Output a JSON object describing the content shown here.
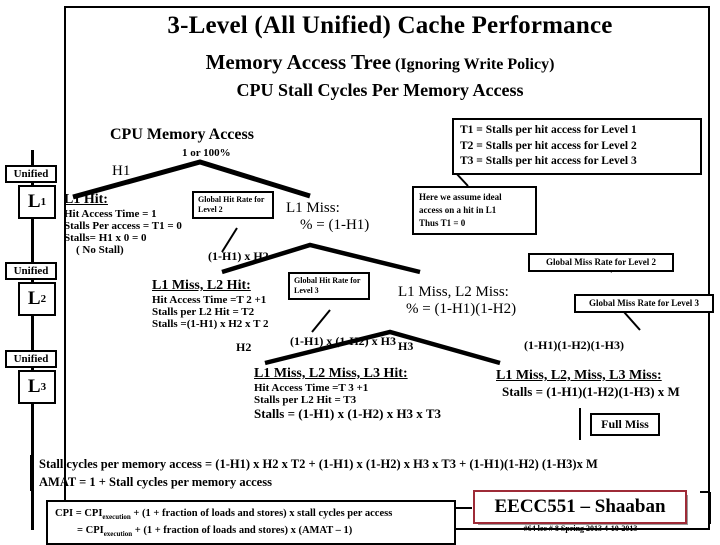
{
  "slide": {
    "title": "3-Level (All Unified) Cache Performance",
    "subtitle_main": "Memory Access Tree",
    "subtitle_paren": "(Ignoring Write Policy)",
    "subtitle_line3": "CPU Stall Cycles Per Memory Access"
  },
  "legend": {
    "t1": "T1 = Stalls per hit access for Level 1",
    "t2": "T2 = Stalls per hit access for Level 2",
    "t3": "T3  = Stalls per hit access for Level 3"
  },
  "tree": {
    "root_label": "CPU Memory  Access",
    "root_rate": "1 or 100%",
    "h1_branch_label": "H1"
  },
  "cache_column": [
    {
      "unified": "Unified",
      "level": "L",
      "sub": "1"
    },
    {
      "unified": "Unified",
      "level": "L",
      "sub": "2"
    },
    {
      "unified": "Unified",
      "level": "L",
      "sub": "3"
    }
  ],
  "nodes": {
    "l1_hit": {
      "title": "L1  Hit:",
      "lines": [
        "Hit Access Time = 1",
        "Stalls Per access = T1 = 0",
        "Stalls= H1 x 0 = 0",
        "( No Stall)"
      ]
    },
    "l1_miss": {
      "title": "L1  Miss:",
      "pct": "%  =  (1-H1)"
    },
    "l1miss_l2hit": {
      "title": "L1  Miss, L2  Hit:",
      "lines": [
        "Hit Access Time =T 2 +1",
        "Stalls per L2 Hit = T2",
        "Stalls =(1-H1) x H2 x T 2"
      ]
    },
    "l1miss_l2miss": {
      "title": "L1  Miss, L2   Miss:",
      "pct": "%  =    (1-H1)(1-H2)"
    },
    "l3_hit": {
      "title": "L1  Miss, L2 Miss, L3  Hit:",
      "lines": [
        "Hit Access Time =T 3 +1",
        "Stalls per L2 Hit = T3"
      ],
      "stalls": "Stalls =  (1-H1) x (1-H2) x H3 x  T3"
    },
    "l3_miss": {
      "title": "L1  Miss, L2, Miss, L3   Miss:",
      "stalls": "Stalls = (1-H1)(1-H2)(1-H3) x M"
    }
  },
  "callouts": {
    "global_hit_l2": "Global Hit Rate for Level 2",
    "global_hit_l3": "Global Hit Rate for Level 3",
    "global_miss_l2": "Global Miss Rate for  Level 2",
    "global_miss_l3": "Global Miss Rate for Level 3",
    "ideal_note": "Here we assume ideal access on a hit in L1 Thus  T1 = 0",
    "ideal_note_lines": [
      "Here we assume ideal",
      "access on a hit in L1",
      "Thus   T1 = 0"
    ],
    "full_miss": "Full Miss"
  },
  "fractions": {
    "l2_hit_frac": "(1-H1) x H2",
    "l2_miss_frac": "(1-H1) x (1-H2) x H3",
    "l3_miss_frac": "(1-H1)(1-H2)(1-H3)"
  },
  "branch_labels": {
    "h2": "H2",
    "h3": "H3"
  },
  "summary": {
    "stall_cycles": "Stall cycles per memory access   =  (1-H1) x H2 x T2  +  (1-H1) x (1-H2) x H3 x T3   + (1-H1)(1-H2) (1-H3)x M",
    "amat": "AMAT  =  1  + Stall cycles per memory access"
  },
  "cpi_box": {
    "line1_pre": "CPI = CPI",
    "line1_sub": "execution",
    "line1_post": "  +  (1 + fraction of loads and stores) x stall cycles per access",
    "line2_pre": "= CPI",
    "line2_sub": "execution",
    "line2_post": "  +  (1 + fraction of loads and stores) x (AMAT – 1)"
  },
  "footer": {
    "course": "EECC551 – Shaaban",
    "meta": "#64   lec # 8    Spring 2013   4-10-2013",
    "accent_color": "#9e2b37"
  }
}
